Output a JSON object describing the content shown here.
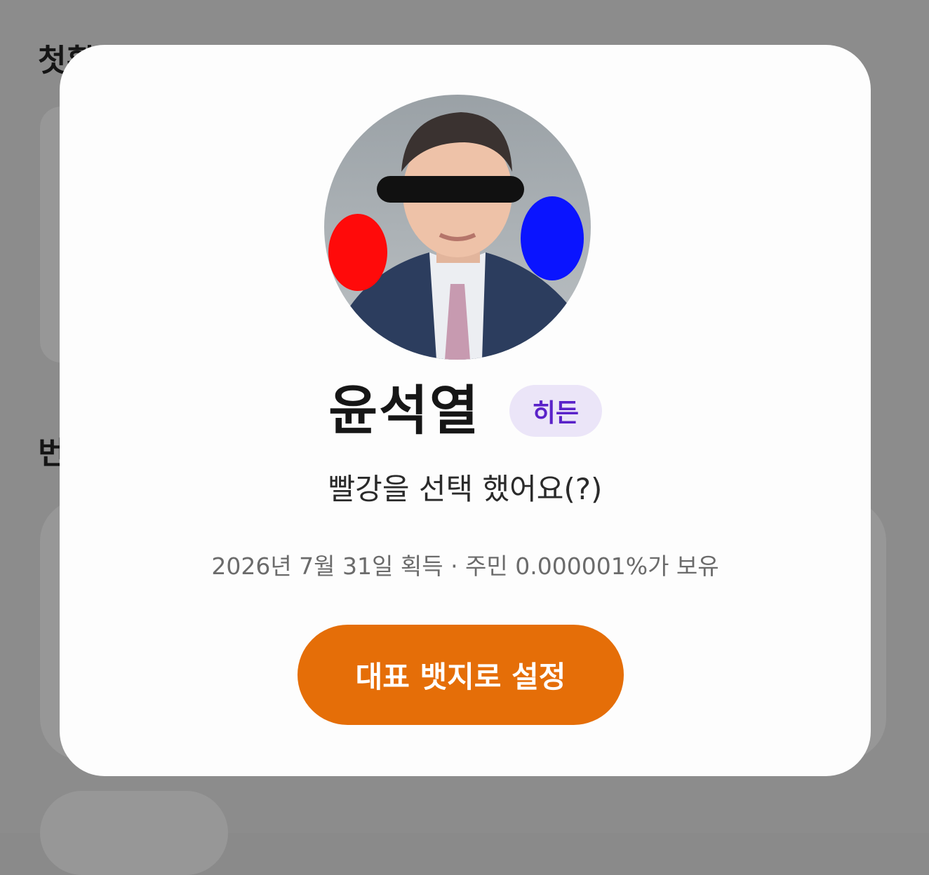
{
  "background": {
    "heading_1": "첫획득",
    "heading_2": "번"
  },
  "modal": {
    "avatar_alt": "badge portrait",
    "name": "윤석열",
    "badge": "히든",
    "subtitle": "빨강을 선택 했어요(?)",
    "meta": "2026년 7월 31일 획득 · 주민 0.000001%가 보유",
    "cta_label": "대표 뱃지로 설정"
  },
  "colors": {
    "accent": "#e56e08",
    "badge_bg": "#ebe5f8",
    "badge_text": "#5a22c9",
    "overlay": "#8c8c8c"
  }
}
